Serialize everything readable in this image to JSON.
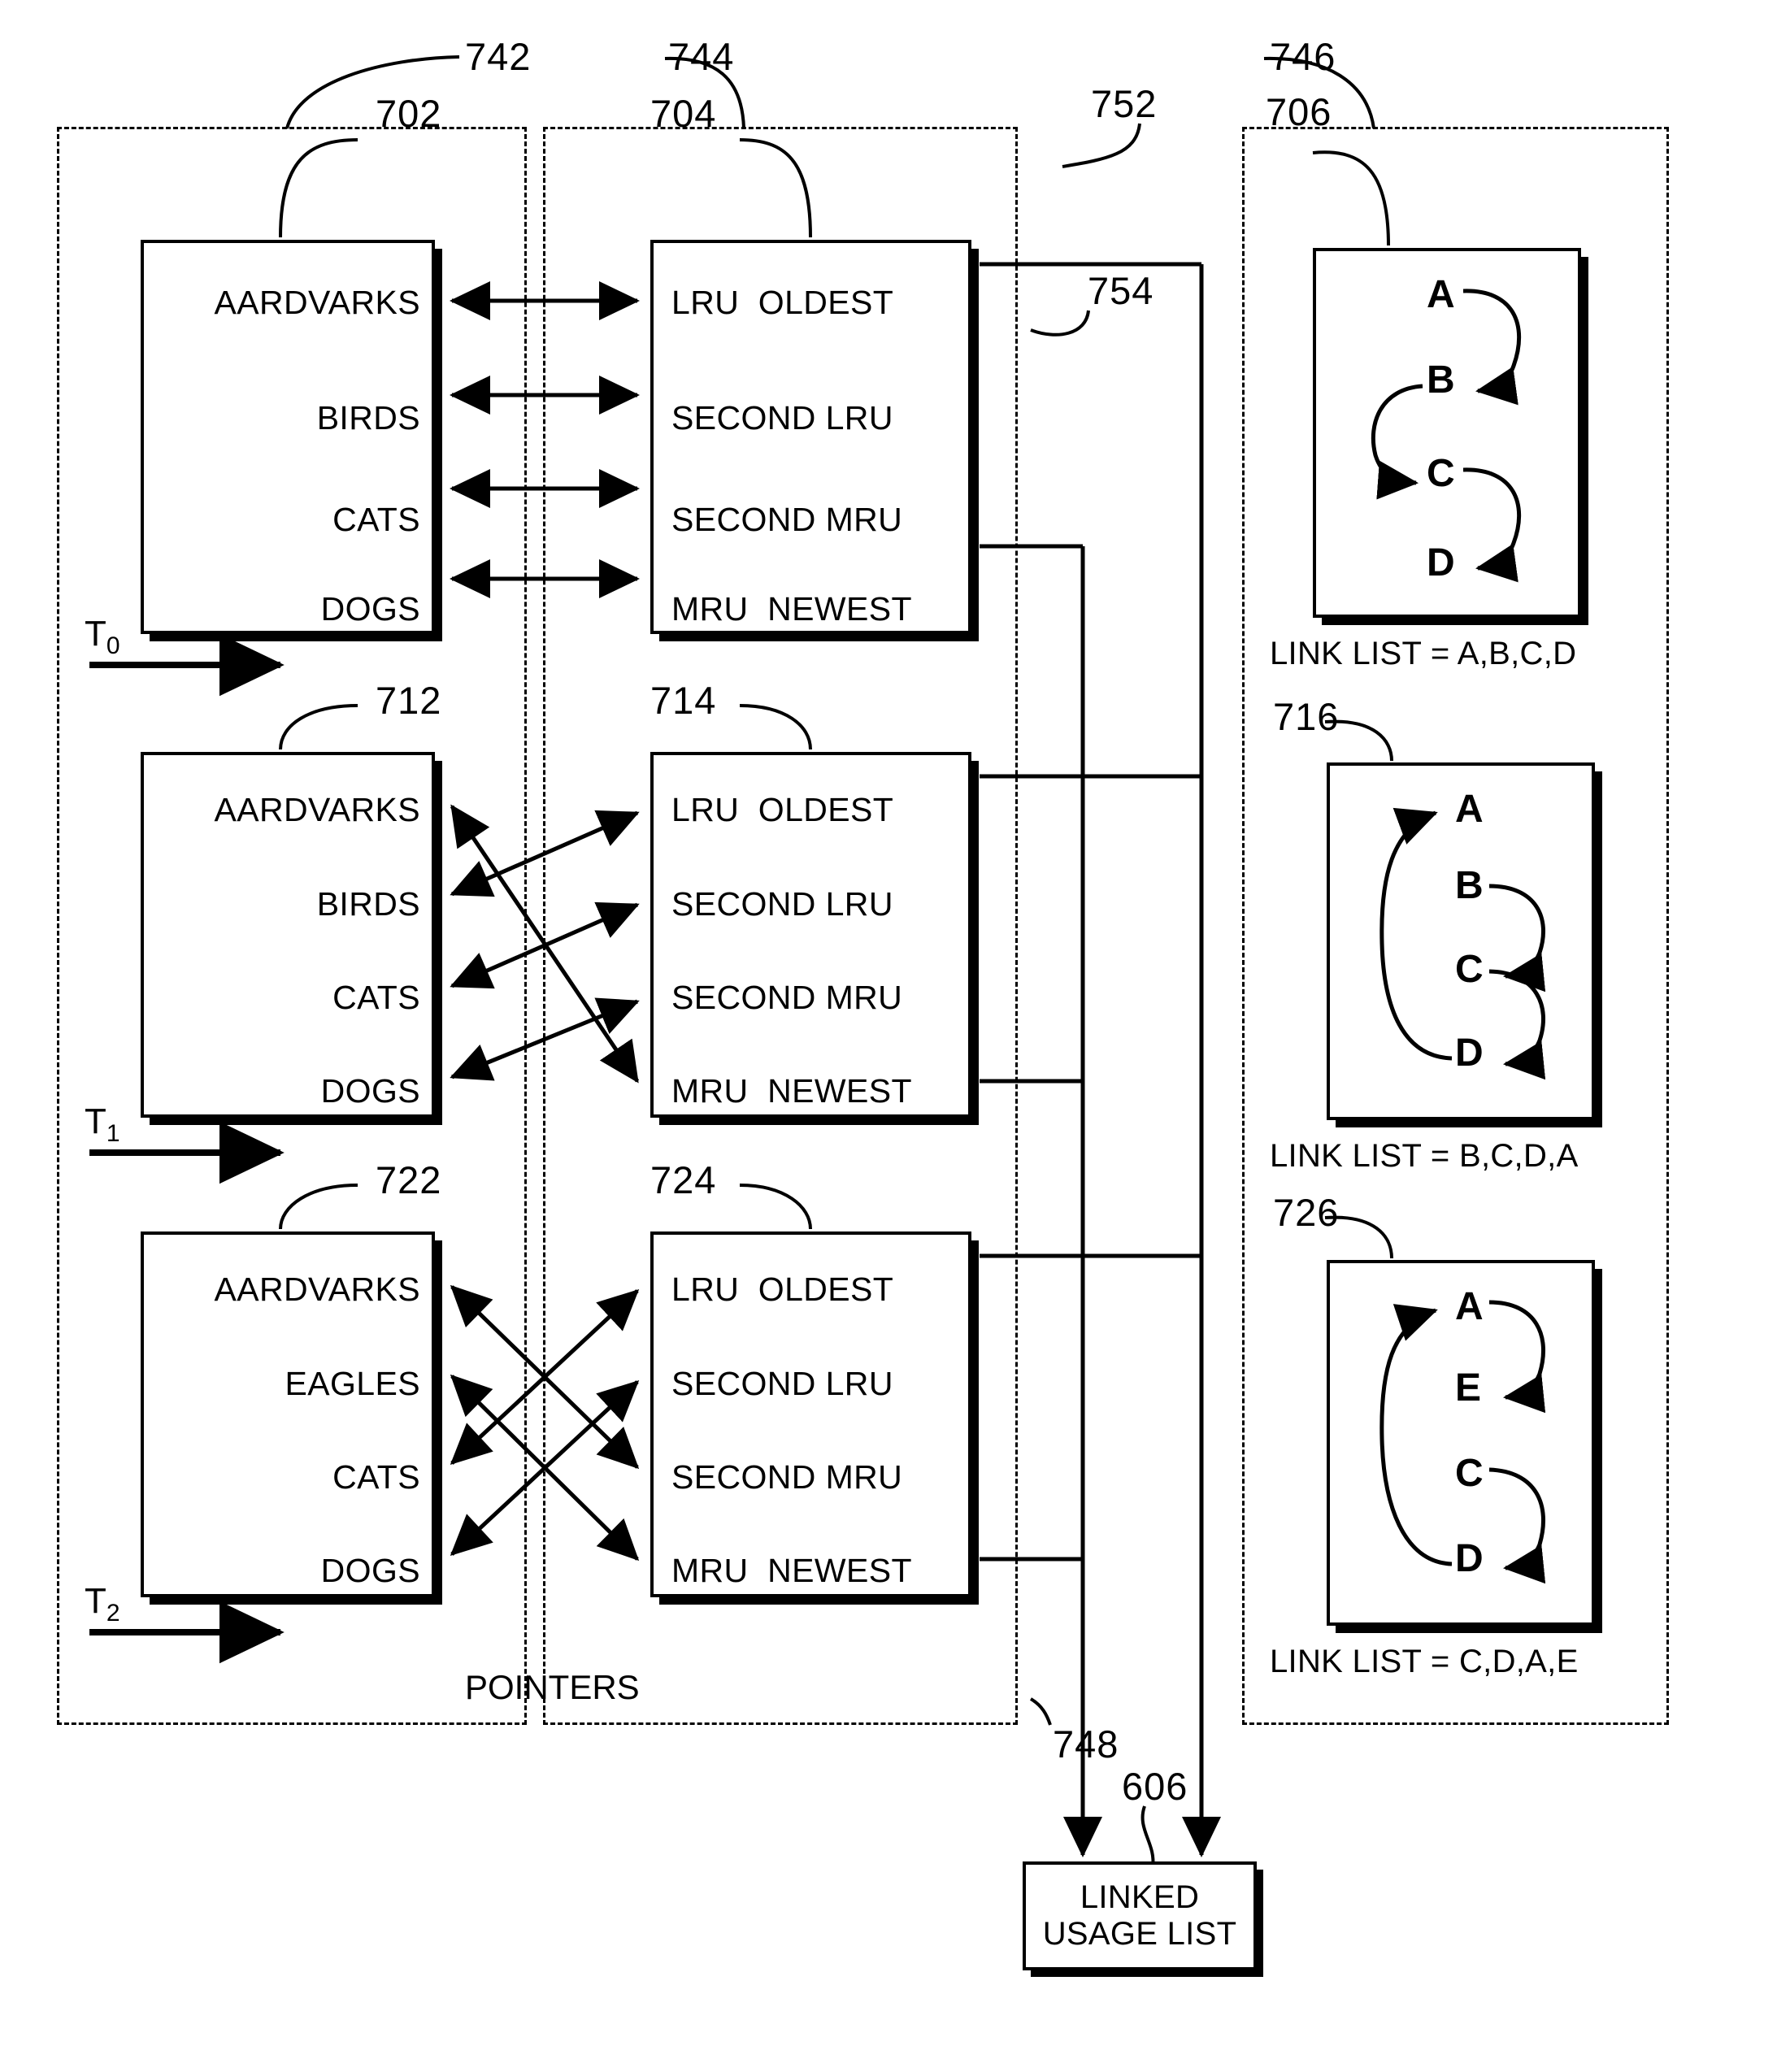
{
  "figure": {
    "type": "patent-diagram",
    "groups": [
      {
        "ref": "742",
        "inner_ref_labels": [
          "702",
          "712",
          "722"
        ]
      },
      {
        "ref": "744",
        "inner_ref_labels": [
          "704",
          "714",
          "724"
        ]
      },
      {
        "ref": "746",
        "inner_ref_labels": [
          "706",
          "716",
          "726"
        ]
      }
    ]
  },
  "refs": {
    "g742": "742",
    "g744": "744",
    "g746": "746",
    "b702": "702",
    "b704": "704",
    "b706": "706",
    "b712": "712",
    "b714": "714",
    "b716": "716",
    "b722": "722",
    "b724": "724",
    "b726": "726",
    "l752": "752",
    "l754": "754",
    "l748": "748",
    "l606": "606"
  },
  "time_labels": {
    "t0": "T",
    "t0sub": "0",
    "t1": "T",
    "t1sub": "1",
    "t2": "T",
    "t2sub": "2"
  },
  "pointers_label": "POINTERS",
  "linked_usage_list": {
    "line1": "LINKED",
    "line2": "USAGE LIST"
  },
  "slot_labels": [
    "LRU  OLDEST",
    "SECOND LRU",
    "SECOND MRU",
    "MRU  NEWEST"
  ],
  "rows": [
    {
      "id": "T0",
      "names_box": "702",
      "slots_box": "704",
      "names": [
        "AARDVARKS",
        "BIRDS",
        "CATS",
        "DOGS"
      ],
      "slots": [
        "LRU  OLDEST",
        "SECOND LRU",
        "SECOND MRU",
        "MRU  NEWEST"
      ],
      "mapping": [
        {
          "name_index": 0,
          "slot_index": 0
        },
        {
          "name_index": 1,
          "slot_index": 1
        },
        {
          "name_index": 2,
          "slot_index": 2
        },
        {
          "name_index": 3,
          "slot_index": 3
        }
      ],
      "list_box": "706",
      "nodes": [
        "A",
        "B",
        "C",
        "D"
      ],
      "links": [
        [
          "A",
          "B"
        ],
        [
          "B",
          "C"
        ],
        [
          "C",
          "D"
        ]
      ],
      "caption": "LINK LIST = A,B,C,D"
    },
    {
      "id": "T1",
      "names_box": "712",
      "slots_box": "714",
      "names": [
        "AARDVARKS",
        "BIRDS",
        "CATS",
        "DOGS"
      ],
      "slots": [
        "LRU  OLDEST",
        "SECOND LRU",
        "SECOND MRU",
        "MRU  NEWEST"
      ],
      "mapping": [
        {
          "name_index": 1,
          "slot_index": 0
        },
        {
          "name_index": 2,
          "slot_index": 1
        },
        {
          "name_index": 3,
          "slot_index": 2
        },
        {
          "name_index": 0,
          "slot_index": 3
        }
      ],
      "list_box": "716",
      "nodes": [
        "A",
        "B",
        "C",
        "D"
      ],
      "links": [
        [
          "B",
          "C"
        ],
        [
          "C",
          "D"
        ],
        [
          "D",
          "A"
        ]
      ],
      "caption": "LINK LIST = B,C,D,A"
    },
    {
      "id": "T2",
      "names_box": "722",
      "slots_box": "724",
      "names": [
        "AARDVARKS",
        "EAGLES",
        "CATS",
        "DOGS"
      ],
      "slots": [
        "LRU  OLDEST",
        "SECOND LRU",
        "SECOND MRU",
        "MRU  NEWEST"
      ],
      "mapping": [
        {
          "name_index": 2,
          "slot_index": 0
        },
        {
          "name_index": 3,
          "slot_index": 1
        },
        {
          "name_index": 0,
          "slot_index": 2
        },
        {
          "name_index": 1,
          "slot_index": 3
        }
      ],
      "list_box": "726",
      "nodes": [
        "A",
        "E",
        "C",
        "D"
      ],
      "links": [
        [
          "A",
          "E"
        ],
        [
          "C",
          "D"
        ],
        [
          "D",
          "A"
        ]
      ],
      "caption": "LINK LIST = C,D,A,E"
    }
  ],
  "colors": {
    "ink": "#000000",
    "paper": "#ffffff"
  }
}
